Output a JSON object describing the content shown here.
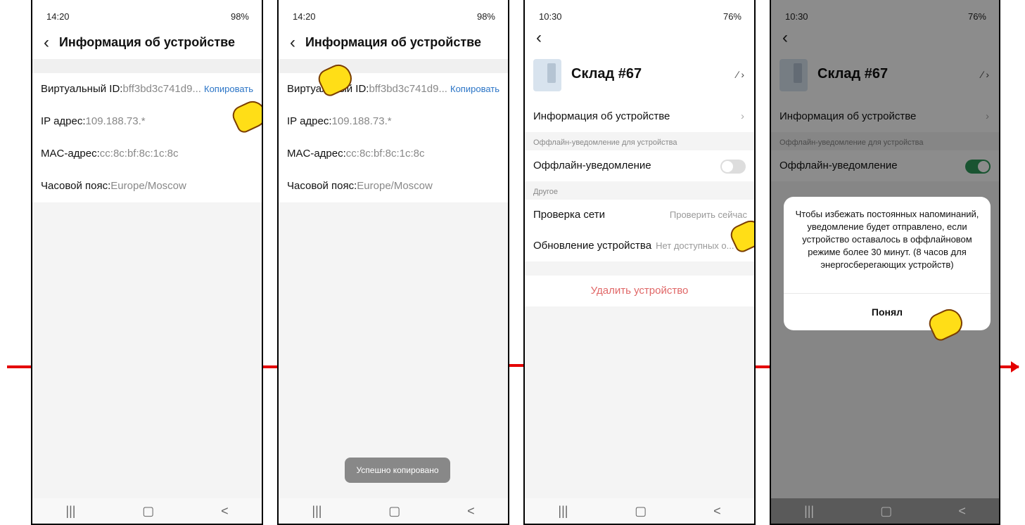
{
  "screen1": {
    "status": {
      "time": "14:20",
      "right": "98%"
    },
    "nav": {
      "title": "Информация об устройстве"
    },
    "rows": [
      {
        "label": "Виртуальный ID:",
        "value": "bff3bd3c741d9...",
        "action": "Копировать"
      },
      {
        "label": "IP адрес:",
        "value": "109.188.73.*"
      },
      {
        "label": "MAC-адрес:",
        "value": "cc:8c:bf:8c:1c:8c"
      },
      {
        "label": "Часовой пояс:",
        "value": "Europe/Moscow"
      }
    ]
  },
  "screen2": {
    "status": {
      "time": "14:20",
      "right": "98%"
    },
    "nav": {
      "title": "Информация об устройстве"
    },
    "rows": [
      {
        "label": "Виртуальный ID:",
        "value": "bff3bd3c741d9...",
        "action": "Копировать"
      },
      {
        "label": "IP адрес:",
        "value": "109.188.73.*"
      },
      {
        "label": "MAC-адрес:",
        "value": "cc:8c:bf:8c:1c:8c"
      },
      {
        "label": "Часовой пояс:",
        "value": "Europe/Moscow"
      }
    ],
    "toast": "Успешно копировано"
  },
  "screen3": {
    "status": {
      "time": "10:30",
      "right": "76%"
    },
    "device_name": "Склад #67",
    "info_row": "Информация об устройстве",
    "offline_section": "Оффлайн-уведомление для устройства",
    "offline_label": "Оффлайн-уведомление",
    "other_section": "Другое",
    "network_label": "Проверка сети",
    "network_action": "Проверить сейчас",
    "update_label": "Обновление устройства",
    "update_value": "Нет доступных о...",
    "delete_label": "Удалить устройство"
  },
  "screen4": {
    "status": {
      "time": "10:30",
      "right": "76%"
    },
    "device_name": "Склад #67",
    "info_row": "Информация об устройстве",
    "offline_section": "Оффлайн-уведомление для устройства",
    "offline_label": "Оффлайн-уведомление",
    "dialog_text": "Чтобы избежать постоянных напоминаний, уведомление будет отправлено, если устройство оставалось в оффлайновом режиме более 30 минут. (8 часов для энергосберегающих устройств)",
    "dialog_button": "Понял"
  },
  "system_nav": {
    "recent": "|||",
    "home": "▢",
    "back": "<"
  },
  "colors": {
    "accent": "#2a74c6",
    "toggle_on": "#2f9a5a",
    "danger": "#e06767",
    "arrow": "#e40000"
  }
}
